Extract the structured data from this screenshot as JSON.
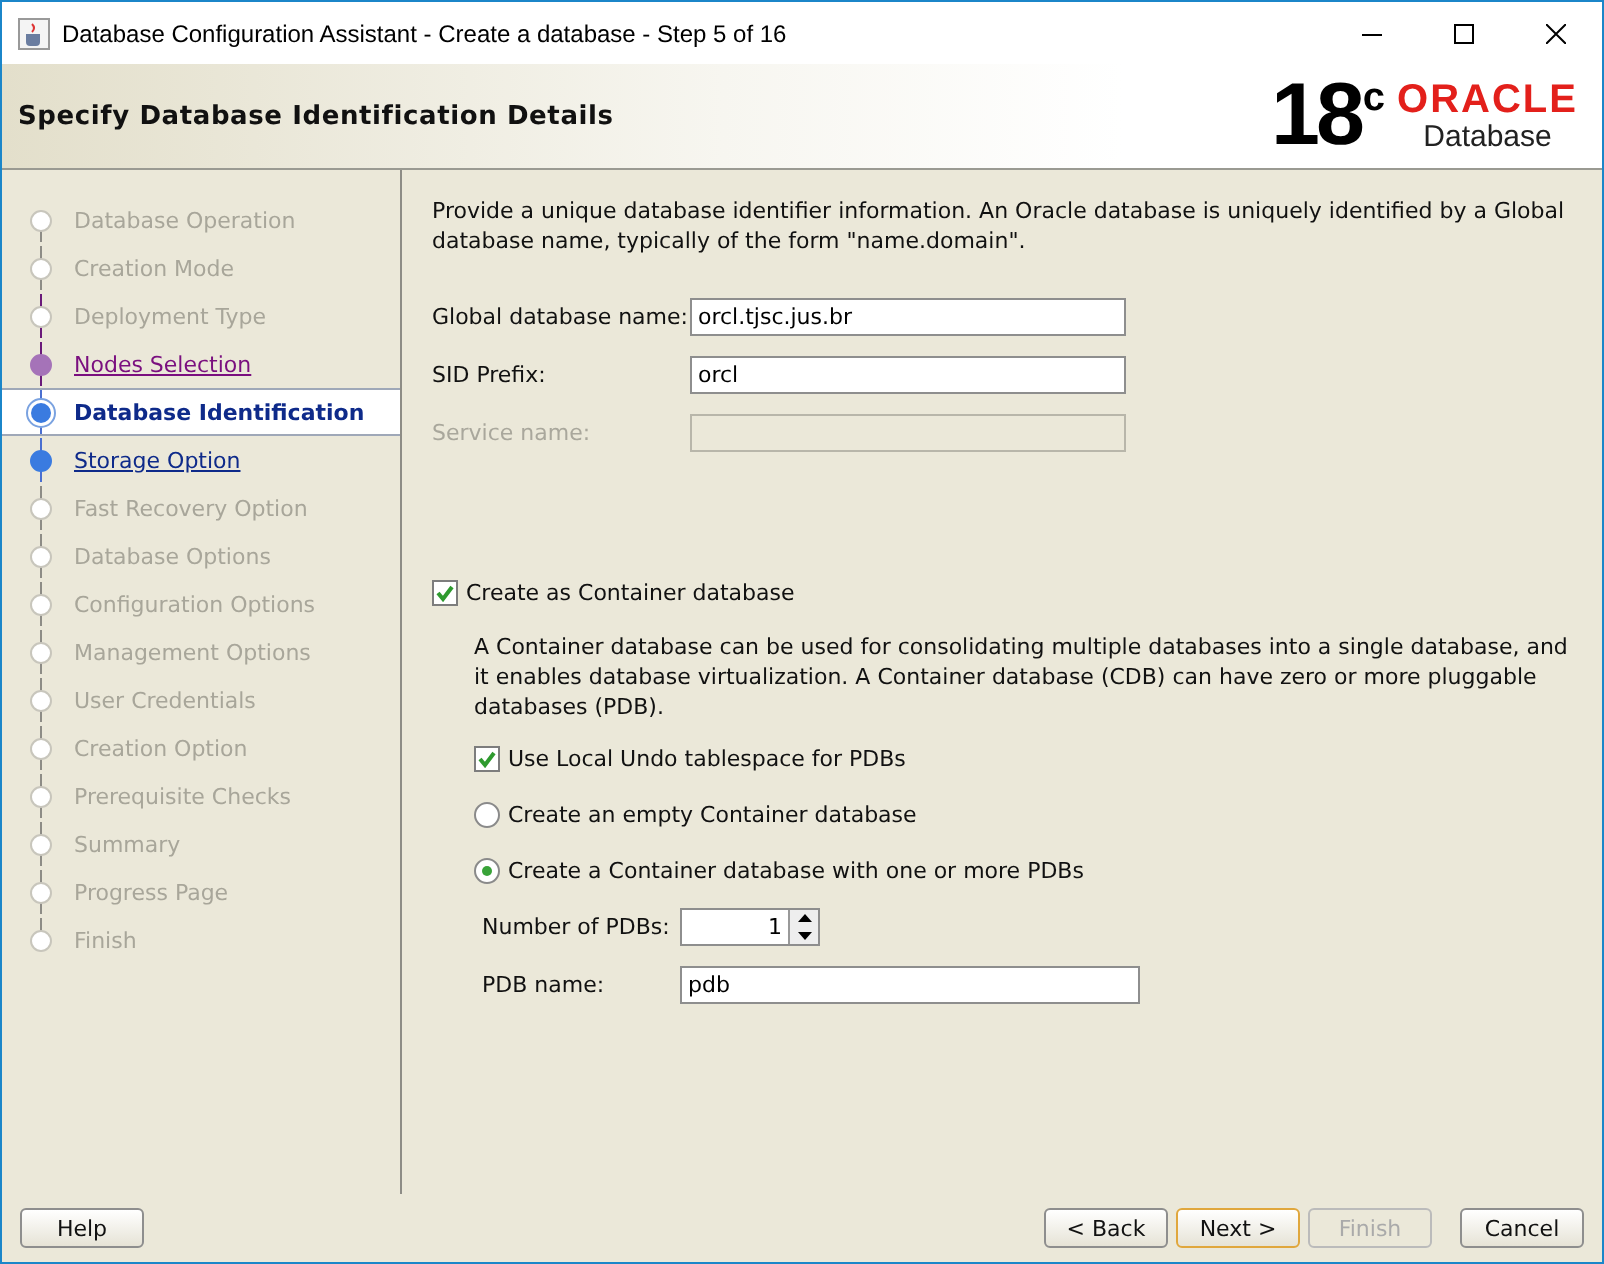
{
  "window": {
    "title": "Database Configuration Assistant - Create a database - Step 5 of 16"
  },
  "header": {
    "title": "Specify Database Identification Details",
    "logo": {
      "version": "18",
      "version_sup": "c",
      "brand": "ORACLE",
      "product": "Database"
    }
  },
  "steps": [
    {
      "label": "Database Operation",
      "selected": false,
      "visited": false,
      "disabled": true
    },
    {
      "label": "Creation Mode",
      "selected": false,
      "visited": false,
      "disabled": true
    },
    {
      "label": "Deployment Type",
      "selected": false,
      "visited": false,
      "disabled": true
    },
    {
      "label": "Nodes Selection",
      "selected": false,
      "visited": true,
      "disabled": false
    },
    {
      "label": "Database Identification",
      "selected": true,
      "visited": false,
      "disabled": false
    },
    {
      "label": "Storage Option",
      "selected": false,
      "visited": false,
      "disabled": false
    },
    {
      "label": "Fast Recovery Option",
      "selected": false,
      "visited": false,
      "disabled": true
    },
    {
      "label": "Database Options",
      "selected": false,
      "visited": false,
      "disabled": true
    },
    {
      "label": "Configuration Options",
      "selected": false,
      "visited": false,
      "disabled": true
    },
    {
      "label": "Management Options",
      "selected": false,
      "visited": false,
      "disabled": true
    },
    {
      "label": "User Credentials",
      "selected": false,
      "visited": false,
      "disabled": true
    },
    {
      "label": "Creation Option",
      "selected": false,
      "visited": false,
      "disabled": true
    },
    {
      "label": "Prerequisite Checks",
      "selected": false,
      "visited": false,
      "disabled": true
    },
    {
      "label": "Summary",
      "selected": false,
      "visited": false,
      "disabled": true
    },
    {
      "label": "Progress Page",
      "selected": false,
      "visited": false,
      "disabled": true
    },
    {
      "label": "Finish",
      "selected": false,
      "visited": false,
      "disabled": true
    }
  ],
  "intro": "Provide a unique database identifier information. An Oracle database is uniquely identified by a Global database name, typically of the form \"name.domain\".",
  "fields": [
    {
      "label": "Global database name:",
      "value": "orcl.tjsc.jus.br",
      "disabled": false
    },
    {
      "label": "SID Prefix:",
      "value": "orcl",
      "disabled": false
    },
    {
      "label": "Service name:",
      "disabled": true
    }
  ],
  "container": {
    "label": "Create as Container database",
    "checked": true,
    "description": "A Container database can be used for consolidating multiple databases into a single database, and it enables database virtualization. A Container database (CDB) can have zero or more pluggable databases (PDB).",
    "local_undo": {
      "label": "Use Local Undo tablespace for PDBs",
      "checked": true
    },
    "options": [
      {
        "label": "Create an empty Container database",
        "selected": false
      },
      {
        "label": "Create a Container database with one or more PDBs",
        "selected": true
      }
    ],
    "pdb_count": {
      "label": "Number of PDBs:",
      "value": "1"
    },
    "pdb_name": {
      "label": "PDB name:",
      "value": "pdb"
    }
  },
  "buttons_left": [
    {
      "label": "Help",
      "disabled": false,
      "default": false
    }
  ],
  "buttons_right": [
    {
      "label": "< Back",
      "disabled": false,
      "default": false
    },
    {
      "label": "Next >",
      "disabled": false,
      "default": true
    },
    {
      "label": "Finish",
      "disabled": true,
      "default": false
    },
    {
      "label": "Cancel",
      "disabled": false,
      "default": false
    }
  ]
}
